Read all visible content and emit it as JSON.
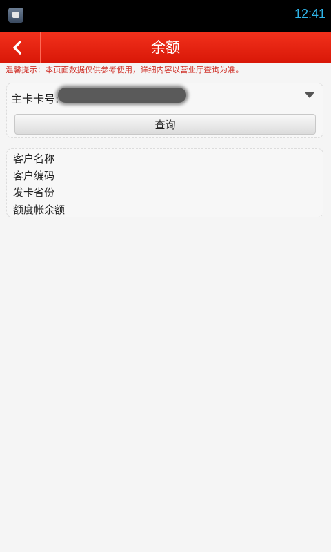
{
  "status_bar": {
    "time": "12:41",
    "app_icon": "camera-app-icon"
  },
  "header": {
    "back_icon": "chevron-left-icon",
    "title": "余额",
    "color": "#e32210"
  },
  "tip": {
    "text": "温馨提示：本页面数据仅供参考使用，详细内容以营业厅查询为准。",
    "color": "#d0342c"
  },
  "query_card": {
    "card_label": "主卡卡号:",
    "card_value": "",
    "dropdown_icon": "caret-down-icon",
    "button_label": "查询"
  },
  "info_card": {
    "items": [
      "客户名称",
      "客户编码",
      "发卡省份",
      "额度帐余额"
    ]
  }
}
